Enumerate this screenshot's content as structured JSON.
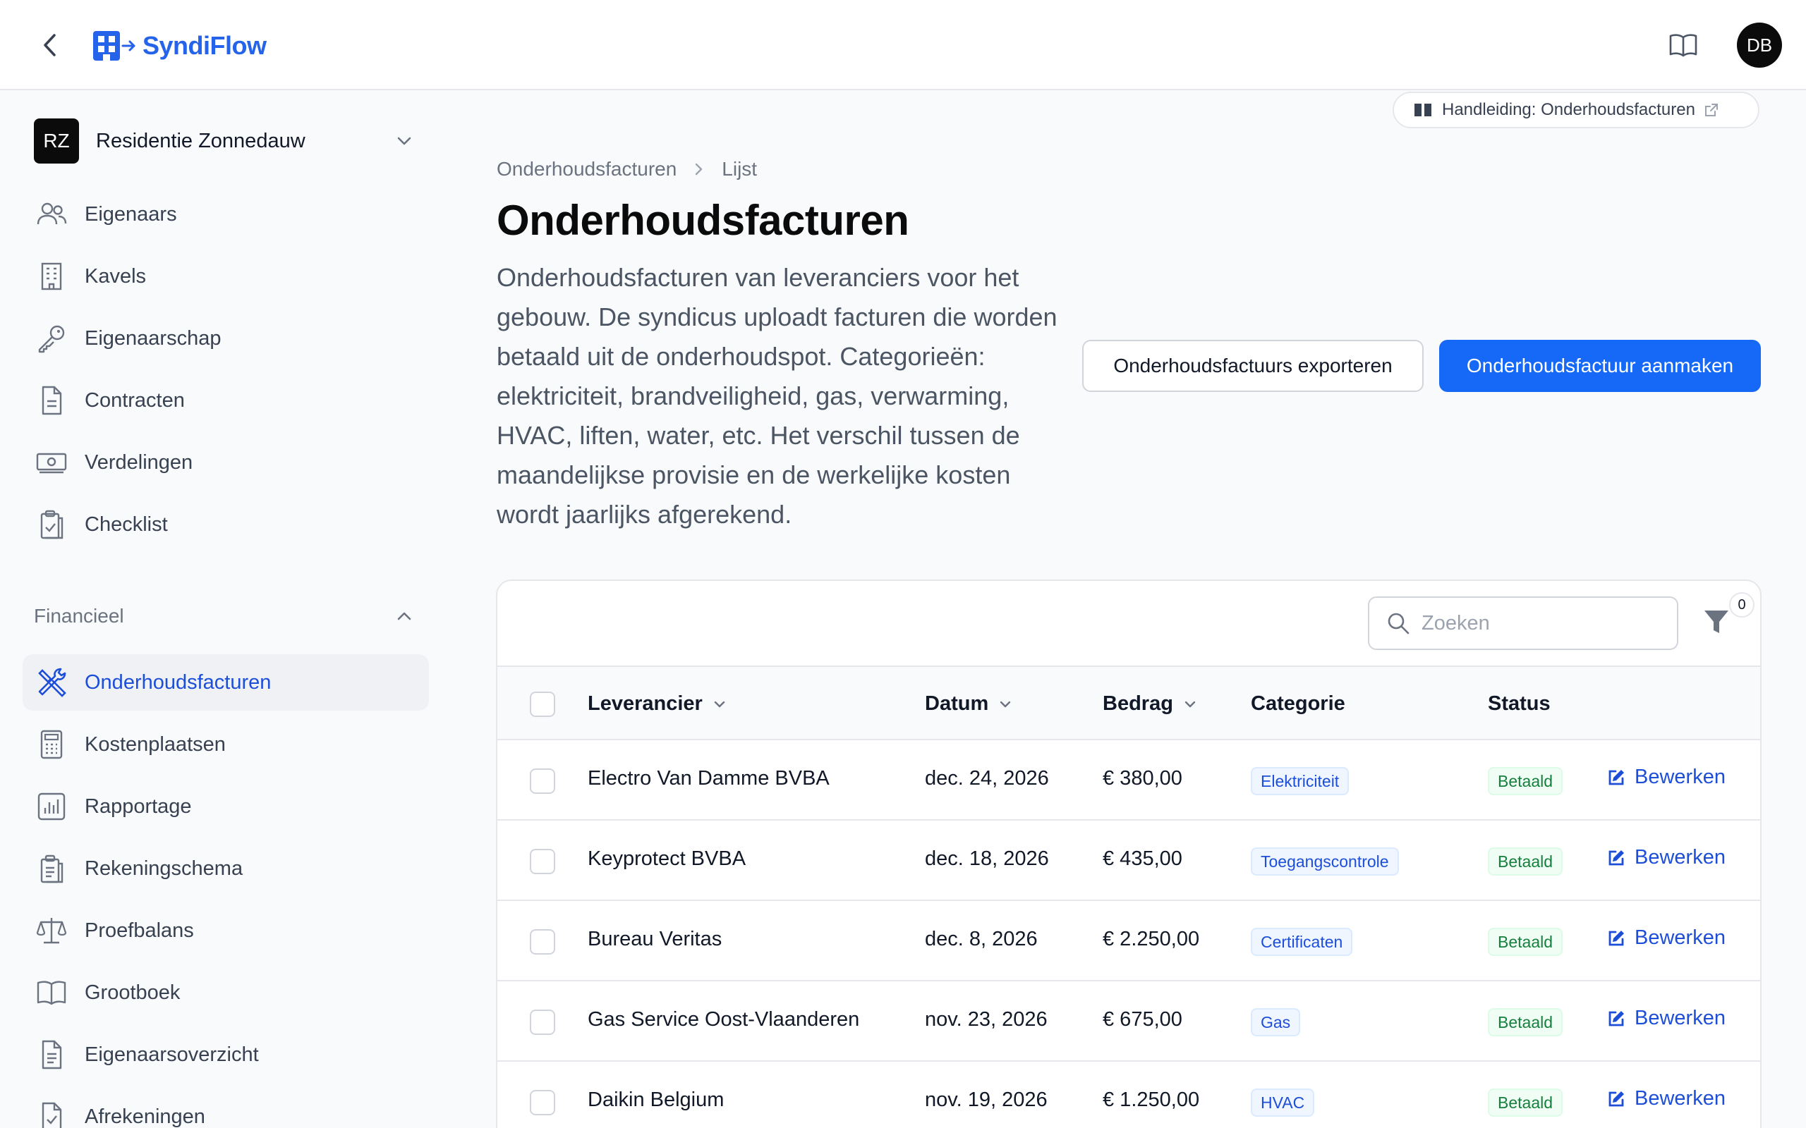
{
  "app": {
    "name": "SyndiFlow",
    "user_initials": "DB"
  },
  "sidebar": {
    "org": {
      "initials": "RZ",
      "name": "Residentie Zonnedauw"
    },
    "items": [
      {
        "label": "Eigenaars",
        "icon": "users-icon"
      },
      {
        "label": "Kavels",
        "icon": "building-icon"
      },
      {
        "label": "Eigenaarschap",
        "icon": "key-icon"
      },
      {
        "label": "Contracten",
        "icon": "document-icon"
      },
      {
        "label": "Verdelingen",
        "icon": "banknote-icon"
      },
      {
        "label": "Checklist",
        "icon": "clipboard-check-icon"
      }
    ],
    "section_title": "Financieel",
    "finance_items": [
      {
        "label": "Onderhoudsfacturen",
        "icon": "wrench-screwdriver-icon",
        "active": true
      },
      {
        "label": "Kostenplaatsen",
        "icon": "calculator-icon"
      },
      {
        "label": "Rapportage",
        "icon": "chart-bar-icon"
      },
      {
        "label": "Rekeningschema",
        "icon": "clipboard-list-icon"
      },
      {
        "label": "Proefbalans",
        "icon": "scale-icon"
      },
      {
        "label": "Grootboek",
        "icon": "book-open-icon"
      },
      {
        "label": "Eigenaarsoverzicht",
        "icon": "document-text-icon"
      },
      {
        "label": "Afrekeningen",
        "icon": "document-check-icon"
      }
    ]
  },
  "main": {
    "manual_link": "Handleiding: Onderhoudsfacturen",
    "breadcrumb": [
      "Onderhoudsfacturen",
      "Lijst"
    ],
    "title": "Onderhoudsfacturen",
    "description": "Onderhoudsfacturen van leveranciers voor het gebouw. De syndicus uploadt facturen die worden betaald uit de onderhoudspot. Categorieën: elektriciteit, brandveiligheid, gas, verwarming, HVAC, liften, water, etc. Het verschil tussen de maandelijkse provisie en de werkelijke kosten wordt jaarlijks afgerekend.",
    "export_label": "Onderhoudsfactuurs exporteren",
    "create_label": "Onderhoudsfactuur aanmaken"
  },
  "table": {
    "search_placeholder": "Zoeken",
    "filter_count": "0",
    "columns": {
      "supplier": "Leverancier",
      "date": "Datum",
      "amount": "Bedrag",
      "category": "Categorie",
      "status": "Status"
    },
    "edit_label": "Bewerken",
    "rows": [
      {
        "supplier": "Electro Van Damme BVBA",
        "date": "dec. 24, 2026",
        "amount": "€ 380,00",
        "category": "Elektriciteit",
        "status": "Betaald"
      },
      {
        "supplier": "Keyprotect BVBA",
        "date": "dec. 18, 2026",
        "amount": "€ 435,00",
        "category": "Toegangscontrole",
        "status": "Betaald"
      },
      {
        "supplier": "Bureau Veritas",
        "date": "dec. 8, 2026",
        "amount": "€ 2.250,00",
        "category": "Certificaten",
        "status": "Betaald"
      },
      {
        "supplier": "Gas Service Oost-Vlaanderen",
        "date": "nov. 23, 2026",
        "amount": "€ 675,00",
        "category": "Gas",
        "status": "Betaald"
      },
      {
        "supplier": "Daikin Belgium",
        "date": "nov. 19, 2026",
        "amount": "€ 1.250,00",
        "category": "HVAC",
        "status": "Betaald"
      }
    ]
  },
  "colors": {
    "accent": "#1668f6",
    "active_text": "#1d4ed8",
    "status_green": "#15803d"
  }
}
